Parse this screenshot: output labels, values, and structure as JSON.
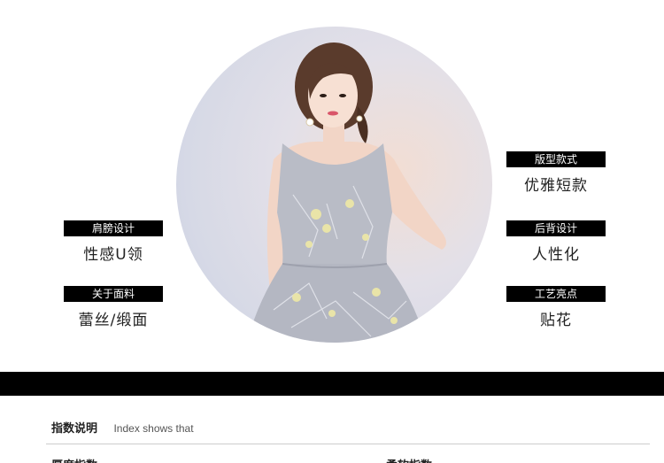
{
  "features": {
    "shoulder": {
      "tag": "肩膀设计",
      "value": "性感U领"
    },
    "fabric": {
      "tag": "关于面料",
      "value": "蕾丝/缎面"
    },
    "style": {
      "tag": "版型款式",
      "value": "优雅短款"
    },
    "back": {
      "tag": "后背设计",
      "value": "人性化"
    },
    "craft": {
      "tag": "工艺亮点",
      "value": "贴花"
    }
  },
  "index": {
    "title": "指数说明",
    "subtitle": "Index shows that",
    "thickness_label": "厚度指数",
    "softness_label": "柔软指数"
  },
  "photo": {
    "icon": "model-dress-photo",
    "dress_color": "#b9bcc6",
    "applique_color": "#e9e4a8"
  }
}
